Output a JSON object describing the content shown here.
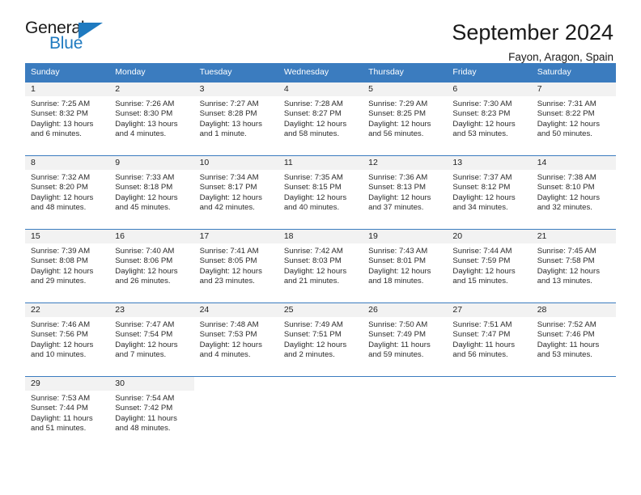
{
  "brand": {
    "name_top": "General",
    "name_bottom": "Blue",
    "triangle_color": "#1f7ac0"
  },
  "header": {
    "title": "September 2024",
    "subtitle": "Fayon, Aragon, Spain"
  },
  "theme": {
    "header_bg": "#3b7cbf",
    "header_text": "#ffffff",
    "daynum_band_bg": "#f2f2f2",
    "cell_bg": "#ffffff",
    "text": "#2b2b2b"
  },
  "weekday_headers": [
    "Sunday",
    "Monday",
    "Tuesday",
    "Wednesday",
    "Thursday",
    "Friday",
    "Saturday"
  ],
  "labels": {
    "sunrise_prefix": "Sunrise:",
    "sunset_prefix": "Sunset:",
    "daylight_prefix": "Daylight:"
  },
  "weeks": [
    [
      {
        "day": "1",
        "sunrise": "Sunrise: 7:25 AM",
        "sunset": "Sunset: 8:32 PM",
        "daylight_1": "Daylight: 13 hours",
        "daylight_2": "and 6 minutes."
      },
      {
        "day": "2",
        "sunrise": "Sunrise: 7:26 AM",
        "sunset": "Sunset: 8:30 PM",
        "daylight_1": "Daylight: 13 hours",
        "daylight_2": "and 4 minutes."
      },
      {
        "day": "3",
        "sunrise": "Sunrise: 7:27 AM",
        "sunset": "Sunset: 8:28 PM",
        "daylight_1": "Daylight: 13 hours",
        "daylight_2": "and 1 minute."
      },
      {
        "day": "4",
        "sunrise": "Sunrise: 7:28 AM",
        "sunset": "Sunset: 8:27 PM",
        "daylight_1": "Daylight: 12 hours",
        "daylight_2": "and 58 minutes."
      },
      {
        "day": "5",
        "sunrise": "Sunrise: 7:29 AM",
        "sunset": "Sunset: 8:25 PM",
        "daylight_1": "Daylight: 12 hours",
        "daylight_2": "and 56 minutes."
      },
      {
        "day": "6",
        "sunrise": "Sunrise: 7:30 AM",
        "sunset": "Sunset: 8:23 PM",
        "daylight_1": "Daylight: 12 hours",
        "daylight_2": "and 53 minutes."
      },
      {
        "day": "7",
        "sunrise": "Sunrise: 7:31 AM",
        "sunset": "Sunset: 8:22 PM",
        "daylight_1": "Daylight: 12 hours",
        "daylight_2": "and 50 minutes."
      }
    ],
    [
      {
        "day": "8",
        "sunrise": "Sunrise: 7:32 AM",
        "sunset": "Sunset: 8:20 PM",
        "daylight_1": "Daylight: 12 hours",
        "daylight_2": "and 48 minutes."
      },
      {
        "day": "9",
        "sunrise": "Sunrise: 7:33 AM",
        "sunset": "Sunset: 8:18 PM",
        "daylight_1": "Daylight: 12 hours",
        "daylight_2": "and 45 minutes."
      },
      {
        "day": "10",
        "sunrise": "Sunrise: 7:34 AM",
        "sunset": "Sunset: 8:17 PM",
        "daylight_1": "Daylight: 12 hours",
        "daylight_2": "and 42 minutes."
      },
      {
        "day": "11",
        "sunrise": "Sunrise: 7:35 AM",
        "sunset": "Sunset: 8:15 PM",
        "daylight_1": "Daylight: 12 hours",
        "daylight_2": "and 40 minutes."
      },
      {
        "day": "12",
        "sunrise": "Sunrise: 7:36 AM",
        "sunset": "Sunset: 8:13 PM",
        "daylight_1": "Daylight: 12 hours",
        "daylight_2": "and 37 minutes."
      },
      {
        "day": "13",
        "sunrise": "Sunrise: 7:37 AM",
        "sunset": "Sunset: 8:12 PM",
        "daylight_1": "Daylight: 12 hours",
        "daylight_2": "and 34 minutes."
      },
      {
        "day": "14",
        "sunrise": "Sunrise: 7:38 AM",
        "sunset": "Sunset: 8:10 PM",
        "daylight_1": "Daylight: 12 hours",
        "daylight_2": "and 32 minutes."
      }
    ],
    [
      {
        "day": "15",
        "sunrise": "Sunrise: 7:39 AM",
        "sunset": "Sunset: 8:08 PM",
        "daylight_1": "Daylight: 12 hours",
        "daylight_2": "and 29 minutes."
      },
      {
        "day": "16",
        "sunrise": "Sunrise: 7:40 AM",
        "sunset": "Sunset: 8:06 PM",
        "daylight_1": "Daylight: 12 hours",
        "daylight_2": "and 26 minutes."
      },
      {
        "day": "17",
        "sunrise": "Sunrise: 7:41 AM",
        "sunset": "Sunset: 8:05 PM",
        "daylight_1": "Daylight: 12 hours",
        "daylight_2": "and 23 minutes."
      },
      {
        "day": "18",
        "sunrise": "Sunrise: 7:42 AM",
        "sunset": "Sunset: 8:03 PM",
        "daylight_1": "Daylight: 12 hours",
        "daylight_2": "and 21 minutes."
      },
      {
        "day": "19",
        "sunrise": "Sunrise: 7:43 AM",
        "sunset": "Sunset: 8:01 PM",
        "daylight_1": "Daylight: 12 hours",
        "daylight_2": "and 18 minutes."
      },
      {
        "day": "20",
        "sunrise": "Sunrise: 7:44 AM",
        "sunset": "Sunset: 7:59 PM",
        "daylight_1": "Daylight: 12 hours",
        "daylight_2": "and 15 minutes."
      },
      {
        "day": "21",
        "sunrise": "Sunrise: 7:45 AM",
        "sunset": "Sunset: 7:58 PM",
        "daylight_1": "Daylight: 12 hours",
        "daylight_2": "and 13 minutes."
      }
    ],
    [
      {
        "day": "22",
        "sunrise": "Sunrise: 7:46 AM",
        "sunset": "Sunset: 7:56 PM",
        "daylight_1": "Daylight: 12 hours",
        "daylight_2": "and 10 minutes."
      },
      {
        "day": "23",
        "sunrise": "Sunrise: 7:47 AM",
        "sunset": "Sunset: 7:54 PM",
        "daylight_1": "Daylight: 12 hours",
        "daylight_2": "and 7 minutes."
      },
      {
        "day": "24",
        "sunrise": "Sunrise: 7:48 AM",
        "sunset": "Sunset: 7:53 PM",
        "daylight_1": "Daylight: 12 hours",
        "daylight_2": "and 4 minutes."
      },
      {
        "day": "25",
        "sunrise": "Sunrise: 7:49 AM",
        "sunset": "Sunset: 7:51 PM",
        "daylight_1": "Daylight: 12 hours",
        "daylight_2": "and 2 minutes."
      },
      {
        "day": "26",
        "sunrise": "Sunrise: 7:50 AM",
        "sunset": "Sunset: 7:49 PM",
        "daylight_1": "Daylight: 11 hours",
        "daylight_2": "and 59 minutes."
      },
      {
        "day": "27",
        "sunrise": "Sunrise: 7:51 AM",
        "sunset": "Sunset: 7:47 PM",
        "daylight_1": "Daylight: 11 hours",
        "daylight_2": "and 56 minutes."
      },
      {
        "day": "28",
        "sunrise": "Sunrise: 7:52 AM",
        "sunset": "Sunset: 7:46 PM",
        "daylight_1": "Daylight: 11 hours",
        "daylight_2": "and 53 minutes."
      }
    ],
    [
      {
        "day": "29",
        "sunrise": "Sunrise: 7:53 AM",
        "sunset": "Sunset: 7:44 PM",
        "daylight_1": "Daylight: 11 hours",
        "daylight_2": "and 51 minutes."
      },
      {
        "day": "30",
        "sunrise": "Sunrise: 7:54 AM",
        "sunset": "Sunset: 7:42 PM",
        "daylight_1": "Daylight: 11 hours",
        "daylight_2": "and 48 minutes."
      },
      {
        "day": "",
        "sunrise": "",
        "sunset": "",
        "daylight_1": "",
        "daylight_2": ""
      },
      {
        "day": "",
        "sunrise": "",
        "sunset": "",
        "daylight_1": "",
        "daylight_2": ""
      },
      {
        "day": "",
        "sunrise": "",
        "sunset": "",
        "daylight_1": "",
        "daylight_2": ""
      },
      {
        "day": "",
        "sunrise": "",
        "sunset": "",
        "daylight_1": "",
        "daylight_2": ""
      },
      {
        "day": "",
        "sunrise": "",
        "sunset": "",
        "daylight_1": "",
        "daylight_2": ""
      }
    ]
  ]
}
